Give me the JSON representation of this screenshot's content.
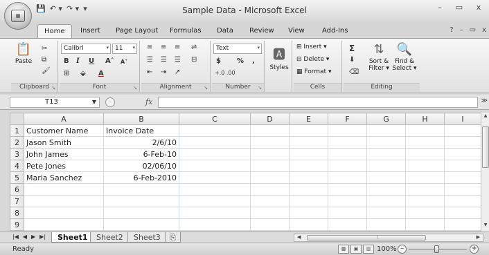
{
  "window": {
    "title": "Sample Data - Microsoft Excel",
    "controls": [
      "–",
      "▭",
      "x"
    ]
  },
  "qat": {
    "save": "💾",
    "undo": "↶ ▾",
    "redo": "↷ ▾",
    "more": "▾"
  },
  "tabs": [
    "Home",
    "Insert",
    "Page Layout",
    "Formulas",
    "Data",
    "Review",
    "View",
    "Add-Ins"
  ],
  "tabs_right": [
    "?",
    "–",
    "▭",
    "x"
  ],
  "ribbon": {
    "clipboard": {
      "label": "Clipboard",
      "paste": "Paste"
    },
    "font": {
      "label": "Font",
      "name": "Calibri",
      "size": "11",
      "bold": "B",
      "italic": "I",
      "underline": "U",
      "grow": "A˄",
      "shrink": "A˅",
      "font_color": "A"
    },
    "alignment": {
      "label": "Alignment"
    },
    "number": {
      "label": "Number",
      "format": "Text",
      "currency": "$",
      "percent": "%",
      "comma": ",",
      "inc_dec": "+.0 .00",
      "dec_dec": ".00 →.0"
    },
    "styles": {
      "label": "Styles"
    },
    "cells": {
      "label": "Cells",
      "insert": "Insert",
      "delete": "Delete",
      "format": "Format"
    },
    "editing": {
      "label": "Editing",
      "sum": "Σ",
      "sort_filter": "Sort &",
      "sort_filter2": "Filter",
      "find_select": "Find &",
      "find_select2": "Select"
    }
  },
  "formula_bar": {
    "cell_ref": "T13",
    "fx": "fx",
    "value": ""
  },
  "grid": {
    "columns": [
      "A",
      "B",
      "C",
      "D",
      "E",
      "F",
      "G",
      "H",
      "I"
    ],
    "rows": [
      {
        "num": "1",
        "a": "Customer Name",
        "b": "Invoice Date"
      },
      {
        "num": "2",
        "a": "Jason Smith",
        "b": "2/6/10"
      },
      {
        "num": "3",
        "a": "John James",
        "b": "6-Feb-10"
      },
      {
        "num": "4",
        "a": "Pete Jones",
        "b": "02/06/10"
      },
      {
        "num": "5",
        "a": "Maria Sanchez",
        "b": "6-Feb-2010"
      },
      {
        "num": "6",
        "a": "",
        "b": ""
      },
      {
        "num": "7",
        "a": "",
        "b": ""
      },
      {
        "num": "8",
        "a": "",
        "b": ""
      },
      {
        "num": "9",
        "a": "",
        "b": ""
      }
    ]
  },
  "sheets": [
    "Sheet1",
    "Sheet2",
    "Sheet3"
  ],
  "status": {
    "text": "Ready",
    "zoom": "100%"
  }
}
